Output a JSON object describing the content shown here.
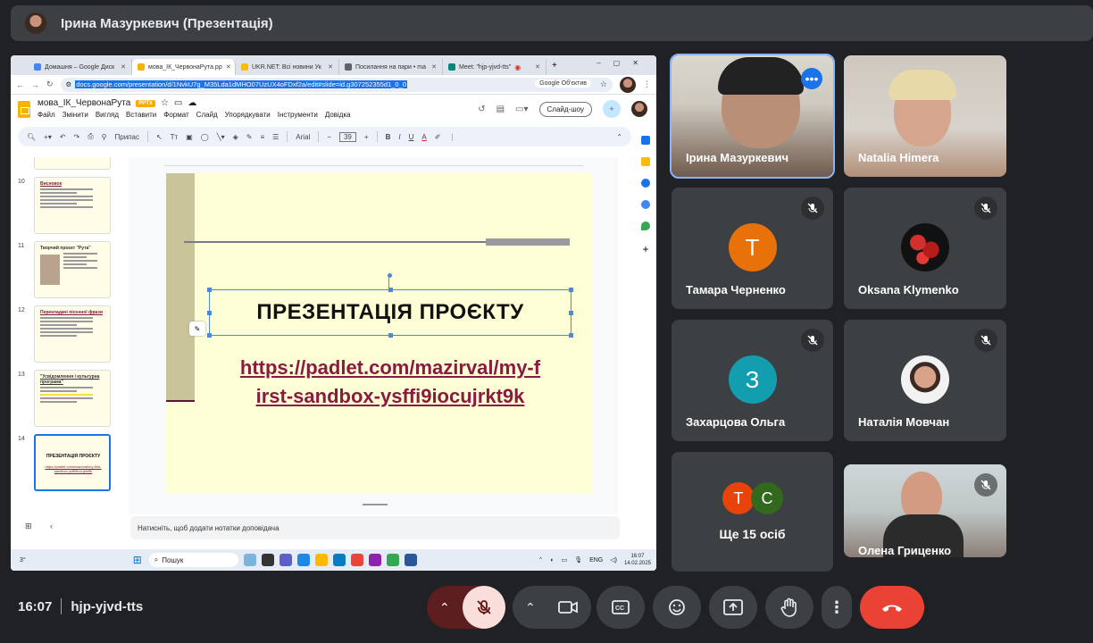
{
  "meeting": {
    "presenter_title": "Ірина Мазуркевич (Презентація)",
    "time": "16:07",
    "code": "hjp-yjvd-tts"
  },
  "browser": {
    "tabs": [
      {
        "label": "Домашня – Google Диск",
        "color": "#4285f4"
      },
      {
        "label": "мова_ІК_ЧервонаРута.pp",
        "color": "#f4b400"
      },
      {
        "label": "UKR.NET: Всі новини Ук",
        "color": "#fbbc04"
      },
      {
        "label": "Посилання на пари • ma",
        "color": "#5f6368"
      },
      {
        "label": "Meet: \"hjp-yjvd-tts\"",
        "color": "#00897b"
      }
    ],
    "new_tab": "+",
    "url": "docs.google.com/presentation/d/1NvkU7g_M35Lda1dMHO07UzUX4oFDxf2a/edit#slide=id.g307252355d1_0_0",
    "omni_chip": "Google Об'єктив"
  },
  "doc": {
    "title": "мова_ІК_ЧервонаРута",
    "badge": "PPTX",
    "menu": [
      "Файл",
      "Змінити",
      "Вигляд",
      "Вставити",
      "Формат",
      "Слайд",
      "Упорядкувати",
      "Інструменти",
      "Довідка"
    ],
    "slideshow_label": "Слайд-шоу",
    "toolbar": {
      "fit_label": "Припас",
      "font": "Arial",
      "font_size": "39"
    },
    "notes_placeholder": "Натисніть, щоб додати нотатки доповідача"
  },
  "filmstrip": [
    {
      "num": "10",
      "title": "Висновок"
    },
    {
      "num": "11",
      "title": "Творчий проєкт \"Рута\""
    },
    {
      "num": "12",
      "title": "Перекладачі пісенної фрази"
    },
    {
      "num": "13",
      "title": "\"Усвідомлення і культурна програма\""
    },
    {
      "num": "14",
      "title": "ПРЕЗЕНТАЦІЯ ПРОЄКТУ",
      "link": "https://padlet.com/mazirval/my-first-sandbox-ysffi9iocujrkt9k"
    }
  ],
  "slide": {
    "title": "ПРЕЗЕНТАЦІЯ ПРОЄКТУ",
    "link_line1": "https://padlet.com/mazirval/my-f",
    "link_line2": "irst-sandbox-ysffi9iocujrkt9k"
  },
  "taskbar": {
    "search": "Пошук",
    "lang": "ENG",
    "clock_time": "16:07",
    "clock_date": "14.02.2025",
    "weather": "3°"
  },
  "participants": [
    {
      "name": "Ірина Мазуркевич",
      "kind": "video"
    },
    {
      "name": "Natalia Himera",
      "kind": "video"
    },
    {
      "name": "Тамара Черненко",
      "kind": "avatar",
      "initial": "Т",
      "color": "#e8710a",
      "muted": true
    },
    {
      "name": "Oksana Klymenko",
      "kind": "photo",
      "muted": true
    },
    {
      "name": "Захарцова Ольга",
      "kind": "avatar",
      "initial": "З",
      "color": "#129eaf",
      "muted": true
    },
    {
      "name": "Наталія Мовчан",
      "kind": "photo",
      "muted": true
    },
    {
      "name": "Ще 15 осіб",
      "kind": "group",
      "initials": [
        "Т",
        "С"
      ],
      "colors": [
        "#e8430a",
        "#33691e"
      ]
    },
    {
      "name": "Олена Гриценко",
      "kind": "video",
      "muted": true
    }
  ],
  "colors": {
    "end_call": "#ea4335",
    "mic_off": "#f9dedc",
    "accent": "#8ab4f8"
  }
}
